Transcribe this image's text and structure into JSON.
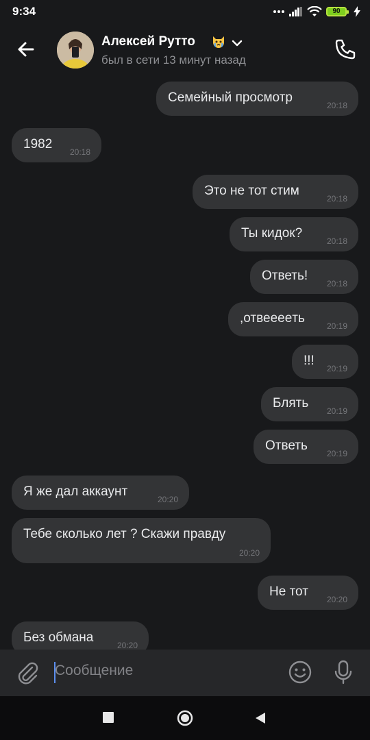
{
  "status_bar": {
    "time": "9:34",
    "battery_level": "90"
  },
  "header": {
    "contact_name": "Алексей Рутто",
    "last_seen": "был в сети 13 минут назад",
    "icons": {
      "back": "arrow-left-icon",
      "call": "phone-icon",
      "name_emoji": "crying-cat-emoji",
      "dropdown": "chevron-down-icon"
    }
  },
  "messages": [
    {
      "direction": "outgoing",
      "text": "Семейный просмотр",
      "time": "20:18"
    },
    {
      "direction": "incoming",
      "text": "1982",
      "time": "20:18"
    },
    {
      "direction": "outgoing",
      "text": "Это не тот стим",
      "time": "20:18"
    },
    {
      "direction": "outgoing",
      "text": "Ты кидок?",
      "time": "20:18"
    },
    {
      "direction": "outgoing",
      "text": "Ответь!",
      "time": "20:18"
    },
    {
      "direction": "outgoing",
      "text": ",отвеееeть",
      "time": "20:19"
    },
    {
      "direction": "outgoing",
      "text": "!!!",
      "time": "20:19"
    },
    {
      "direction": "outgoing",
      "text": "Блять",
      "time": "20:19"
    },
    {
      "direction": "outgoing",
      "text": "Ответь",
      "time": "20:19"
    },
    {
      "direction": "incoming",
      "text": "Я же дал аккаунт",
      "time": "20:20"
    },
    {
      "direction": "incoming",
      "text": "Тебе сколько лет ? Скажи правду",
      "time": "20:20"
    },
    {
      "direction": "outgoing",
      "text": "Не тот",
      "time": "20:20"
    },
    {
      "direction": "incoming",
      "text": "Без обмана",
      "time": "20:20"
    }
  ],
  "composer": {
    "placeholder": "Сообщение",
    "icons": {
      "attach": "paperclip-icon",
      "emoji": "smiley-icon",
      "voice": "microphone-icon"
    }
  },
  "nav_bar": {
    "icons": [
      "square-recents-icon",
      "circle-home-icon",
      "triangle-back-icon"
    ]
  },
  "colors": {
    "background": "#18191b",
    "bubble": "#333436",
    "composer": "#262729",
    "accent_caret": "#5c8ff0",
    "battery": "#7fcf1f"
  }
}
